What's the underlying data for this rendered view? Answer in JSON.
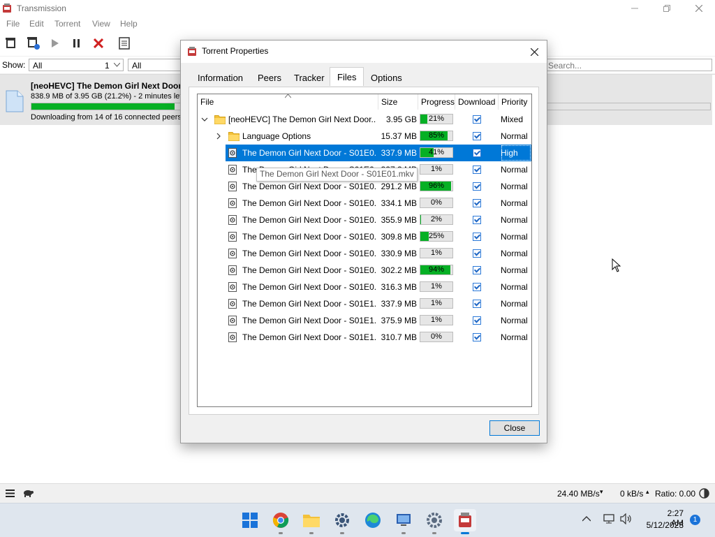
{
  "main_window": {
    "title": "Transmission",
    "menu": [
      "File",
      "Edit",
      "Torrent",
      "View",
      "Help"
    ],
    "filter": {
      "show_label": "Show:",
      "category_value": "All",
      "category_count": "1",
      "tracker_value": "All",
      "search_placeholder": "Search..."
    },
    "torrent": {
      "name": "[neoHEVC] The Demon Girl Next Door",
      "size_line": "838.9 MB of 3.95 GB (21.2%) - 2 minutes left",
      "status_line": "Downloading from 14 of 16 connected peers",
      "progress": 0.212
    },
    "status_bar": {
      "down_speed": "24.40 MB/s",
      "up_speed": "0 kB/s",
      "ratio": "Ratio: 0.00"
    }
  },
  "dialog": {
    "title": "Torrent Properties",
    "tabs": [
      "Information",
      "Peers",
      "Tracker",
      "Files",
      "Options"
    ],
    "active_tab": "Files",
    "columns": [
      "File",
      "Size",
      "Progress",
      "Download",
      "Priority"
    ],
    "rows": [
      {
        "name": "[neoHEVC] The Demon Girl Next Door...",
        "size": "3.95 GB",
        "progress": 21,
        "progress_label": "21%",
        "priority": "Mixed",
        "type": "folder",
        "expander": "open",
        "indent": 0
      },
      {
        "name": "Language Options",
        "size": "15.37 MB",
        "progress": 85,
        "progress_label": "85%",
        "priority": "Normal",
        "type": "folder",
        "expander": "closed",
        "indent": 1
      },
      {
        "name": "The Demon Girl Next Door - S01E0...",
        "size": "337.9 MB",
        "progress": 41,
        "progress_label": "41%",
        "priority": "High",
        "type": "file",
        "selected": true,
        "indent": 1
      },
      {
        "name": "The Demon Girl Next Door - S01E0...",
        "size": "327.2 MB",
        "progress": 1,
        "progress_label": "1%",
        "priority": "Normal",
        "type": "file",
        "indent": 1
      },
      {
        "name": "The Demon Girl Next Door - S01E0...",
        "size": "291.2 MB",
        "progress": 96,
        "progress_label": "96%",
        "priority": "Normal",
        "type": "file",
        "indent": 1
      },
      {
        "name": "The Demon Girl Next Door - S01E0...",
        "size": "334.1 MB",
        "progress": 0,
        "progress_label": "0%",
        "priority": "Normal",
        "type": "file",
        "indent": 1
      },
      {
        "name": "The Demon Girl Next Door - S01E0...",
        "size": "355.9 MB",
        "progress": 2,
        "progress_label": "2%",
        "priority": "Normal",
        "type": "file",
        "indent": 1
      },
      {
        "name": "The Demon Girl Next Door - S01E0...",
        "size": "309.8 MB",
        "progress": 25,
        "progress_label": "25%",
        "priority": "Normal",
        "type": "file",
        "indent": 1
      },
      {
        "name": "The Demon Girl Next Door - S01E0...",
        "size": "330.9 MB",
        "progress": 1,
        "progress_label": "1%",
        "priority": "Normal",
        "type": "file",
        "indent": 1
      },
      {
        "name": "The Demon Girl Next Door - S01E0...",
        "size": "302.2 MB",
        "progress": 94,
        "progress_label": "94%",
        "priority": "Normal",
        "type": "file",
        "indent": 1
      },
      {
        "name": "The Demon Girl Next Door - S01E0...",
        "size": "316.3 MB",
        "progress": 1,
        "progress_label": "1%",
        "priority": "Normal",
        "type": "file",
        "indent": 1
      },
      {
        "name": "The Demon Girl Next Door - S01E1...",
        "size": "337.9 MB",
        "progress": 1,
        "progress_label": "1%",
        "priority": "Normal",
        "type": "file",
        "indent": 1
      },
      {
        "name": "The Demon Girl Next Door - S01E1...",
        "size": "375.9 MB",
        "progress": 1,
        "progress_label": "1%",
        "priority": "Normal",
        "type": "file",
        "indent": 1
      },
      {
        "name": "The Demon Girl Next Door - S01E1...",
        "size": "310.7 MB",
        "progress": 0,
        "progress_label": "0%",
        "priority": "Normal",
        "type": "file",
        "indent": 1
      }
    ],
    "tooltip": "The Demon Girl Next Door - S01E01.mkv",
    "close_label": "Close"
  },
  "taskbar": {
    "time": "2:27 AM",
    "date": "5/12/2023",
    "notification_count": "1",
    "apps": [
      "start-icon",
      "chrome-icon",
      "file-explorer-icon",
      "settings-icon",
      "edge-icon",
      "remote-desktop-icon",
      "settings-gear-icon",
      "transmission-icon"
    ]
  },
  "colors": {
    "accent": "#0078d7",
    "progress_green": "#06b025",
    "selection_blue": "#0078d7"
  }
}
